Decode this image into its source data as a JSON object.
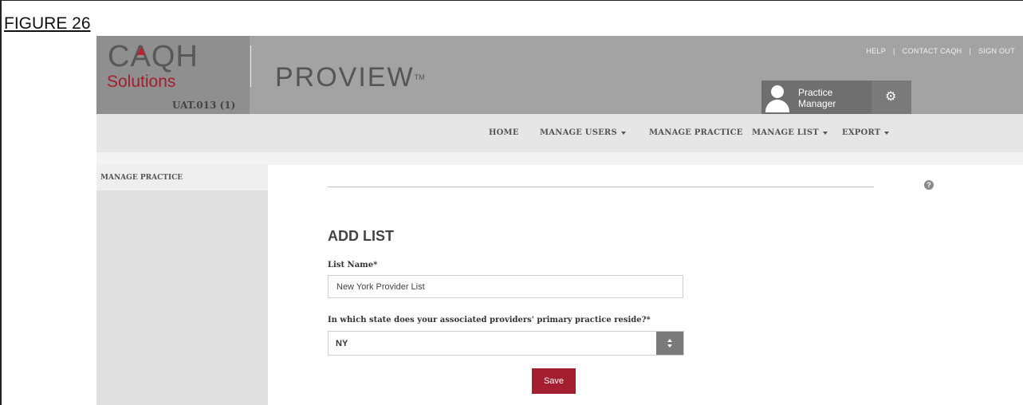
{
  "figure_label": "FIGURE 26",
  "brand": {
    "caqh": "CAQH",
    "solutions": "Solutions",
    "environment": "UAT.013 (1)",
    "product": "PROVIEW",
    "trademark": "TM"
  },
  "top_links": [
    "HELP",
    "CONTACT CAQH",
    "SIGN OUT"
  ],
  "user": {
    "name": "Practice Manager",
    "avatar_icon": "user-avatar-icon",
    "settings_icon": "gear-icon"
  },
  "nav": {
    "home": "HOME",
    "manage_users": "MANAGE USERS",
    "manage_practice": "MANAGE PRACTICE",
    "manage_list": "MANAGE LIST",
    "export": "EXPORT"
  },
  "sidebar": {
    "items": [
      {
        "label": "MANAGE PRACTICE"
      }
    ]
  },
  "help_icon": "?",
  "form": {
    "title": "ADD LIST",
    "list_name_label": "List Name*",
    "list_name_value": "New York Provider List",
    "state_label": "In which state does your associated providers' primary practice reside?*",
    "state_value": "NY",
    "save_label": "Save"
  },
  "colors": {
    "header_bg": "#a3a3a3",
    "brand_red": "#a11f2b",
    "save_button": "#a31e2e",
    "nav_bg": "#e6e6e6",
    "sidebar_bg": "#e0e0e0"
  }
}
